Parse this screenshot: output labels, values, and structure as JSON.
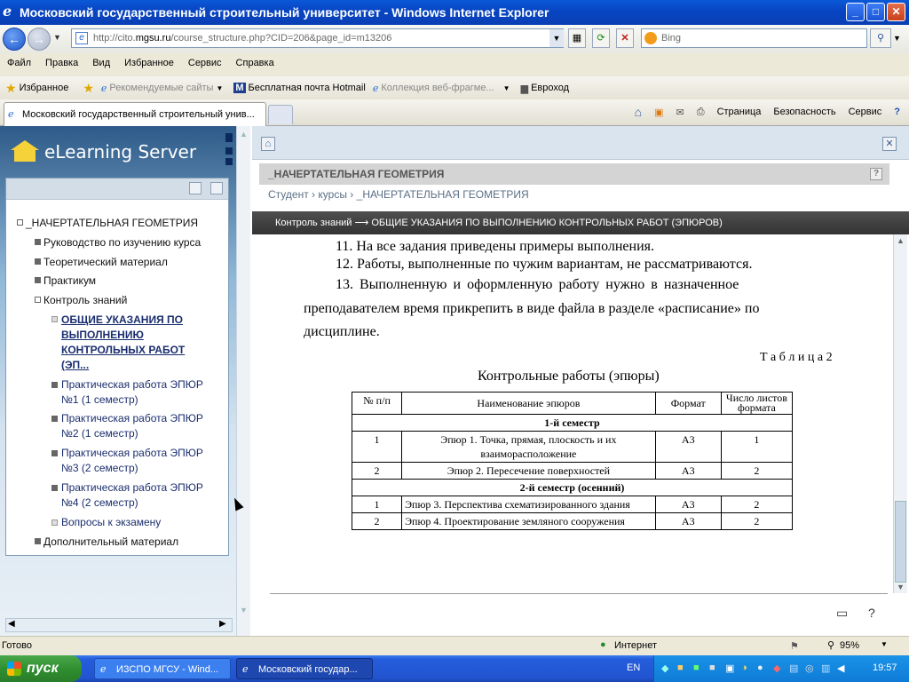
{
  "window": {
    "title": "Московский государственный строительный университет - Windows Internet Explorer"
  },
  "address": {
    "prefix": "http://cito.",
    "host": "mgsu.ru",
    "path": "/course_structure.php?CID=206&page_id=m13206"
  },
  "search": {
    "placeholder": "Bing"
  },
  "menu": [
    "Файл",
    "Правка",
    "Вид",
    "Избранное",
    "Сервис",
    "Справка"
  ],
  "favorites": {
    "label": "Избранное",
    "items": [
      "Рекомендуемые сайты",
      "Бесплатная почта Hotmail",
      "Коллекция веб-фрагме...",
      "Евроход"
    ]
  },
  "tab": {
    "label": "Московский государственный строительный унив..."
  },
  "toolbar": {
    "page": "Страница",
    "safety": "Безопасность",
    "service": "Сервис"
  },
  "logo": {
    "text": "eLearning Server"
  },
  "tree": {
    "root": "_НАЧЕРТАТЕЛЬНАЯ ГЕОМЕТРИЯ",
    "items": [
      "Руководство по изучению курса",
      "Теоретический материал",
      "Практикум",
      "Контроль знаний"
    ],
    "active": [
      "ОБЩИЕ УКАЗАНИЯ ПО",
      "ВЫПОЛНЕНИЮ",
      "КОНТРОЛЬНЫХ РАБОТ",
      "(ЭП..."
    ],
    "subs": [
      [
        "Практическая работа ЭПЮР",
        "№1 (1 семестр)"
      ],
      [
        "Практическая работа ЭПЮР",
        "№2 (1 семестр)"
      ],
      [
        "Практическая работа ЭПЮР",
        "№3 (2 семестр)"
      ],
      [
        "Практическая работа ЭПЮР",
        "№4 (2 семестр)"
      ]
    ],
    "exam": "Вопросы к экзамену",
    "extra": "Дополнительный материал"
  },
  "main": {
    "title": "_НАЧЕРТАТЕЛЬНАЯ ГЕОМЕТРИЯ",
    "breadcrumb": [
      "Студент",
      "курсы",
      "_НАЧЕРТАТЕЛЬНАЯ ГЕОМЕТРИЯ"
    ],
    "section": "Контроль знаний ⟶ ОБЩИЕ УКАЗАНИЯ ПО ВЫПОЛНЕНИЮ КОНТРОЛЬНЫХ РАБОТ (ЭПЮРОВ)"
  },
  "doc": {
    "lines": [
      "11. На все задания приведены примеры выполнения.",
      "12. Работы, выполненные по чужим вариантам, не рассматриваются.",
      "13.  Выполненную  и  оформленную  работу  нужно  в  назначенное",
      "преподавателем время прикрепить в виде файла в разделе «расписание» по",
      "дисциплине."
    ],
    "table_label": "Т а б л и ц а  2",
    "table_caption": "Контрольные работы (эпюры)",
    "headers": [
      "№ п/п",
      "Наименование эпюров",
      "Формат",
      "Число листов формата"
    ],
    "semester1": "1-й семестр",
    "semester2": "2-й семестр (осенний)",
    "rows1": [
      {
        "n": "1",
        "name": "Эпюр 1. Точка, прямая, плоскость и их взаиморасположение",
        "fmt": "А3",
        "count": "1"
      },
      {
        "n": "2",
        "name": "Эпюр 2. Пересечение поверхностей",
        "fmt": "А3",
        "count": "2"
      }
    ],
    "rows2": [
      {
        "n": "1",
        "name": "Эпюр 3. Перспектива схематизированного здания",
        "fmt": "А3",
        "count": "2"
      },
      {
        "n": "2",
        "name": "Эпюр 4. Проектирование земляного сооружения",
        "fmt": "А3",
        "count": "2"
      }
    ]
  },
  "status": {
    "left": "Готово",
    "zone": "Интернет",
    "zoom": "95%"
  },
  "taskbar": {
    "start": "пуск",
    "tasks": [
      "ИЗСПО МГСУ - Wind...",
      "Московский государ..."
    ],
    "lang": "EN",
    "clock": "19:57"
  }
}
